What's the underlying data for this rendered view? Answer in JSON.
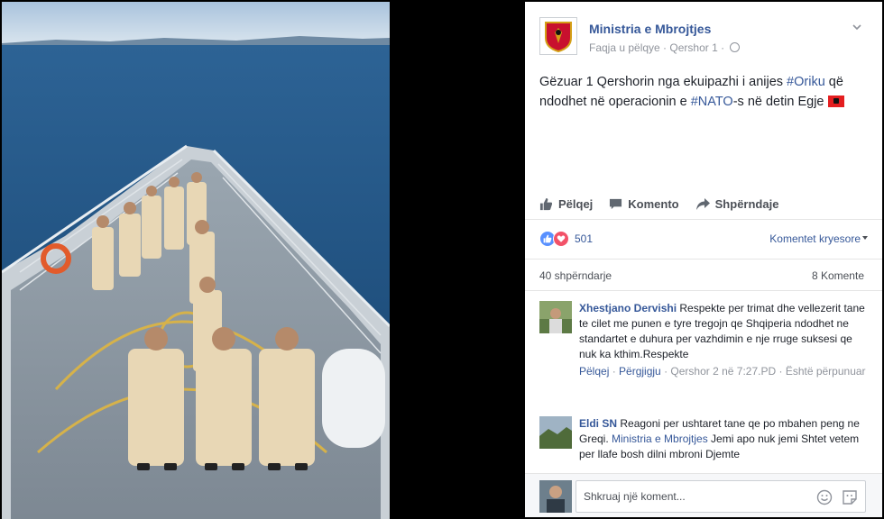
{
  "post": {
    "page_name": "Ministria e Mbrojtjes",
    "meta_prefix": "Faqja u pëlqye · Qershor 1 ·",
    "text_1": "Gëzuar 1 Qershorin nga ekuipazhi i anijes ",
    "tag_1": "#Oriku",
    "text_2": " që ndodhet në operacionin e ",
    "tag_2": "#NATO",
    "text_3": "-s në detin Egje "
  },
  "actions": {
    "like": "Pëlqej",
    "comment": "Komento",
    "share": "Shpërndaje"
  },
  "stats": {
    "reaction_count": "501",
    "top_comments": "Komentet kryesore",
    "shares": "40 shpërndarje",
    "comments": "8 Komente"
  },
  "comments": [
    {
      "name": "Xhestjano Dervishi",
      "text": " Respekte per trimat dhe vellezerit tane te cilet me punen e tyre tregojn qe Shqiperia ndodhet ne standartet e duhura per vazhdimin e nje rruge suksesi qe nuk ka kthim.Respekte",
      "like": "Pëlqej",
      "reply": "Përgjigju",
      "time": "Qershor 2 në 7:27.PD",
      "edited": "Është përpunuar"
    },
    {
      "name": "Eldi SN",
      "text_1": " Reagoni per ushtaret tane qe po mbahen peng ne Greqi. ",
      "link": "Ministria e Mbrojtjes",
      "text_2": " Jemi apo nuk jemi Shtet vetem per llafe bosh dilni mbroni Djemte"
    }
  ],
  "compose": {
    "placeholder": "Shkruaj një koment..."
  },
  "colors": {
    "link": "#365899",
    "like_reaction": "#5890ff",
    "love_reaction": "#f25268",
    "flag": "#e41e20"
  }
}
